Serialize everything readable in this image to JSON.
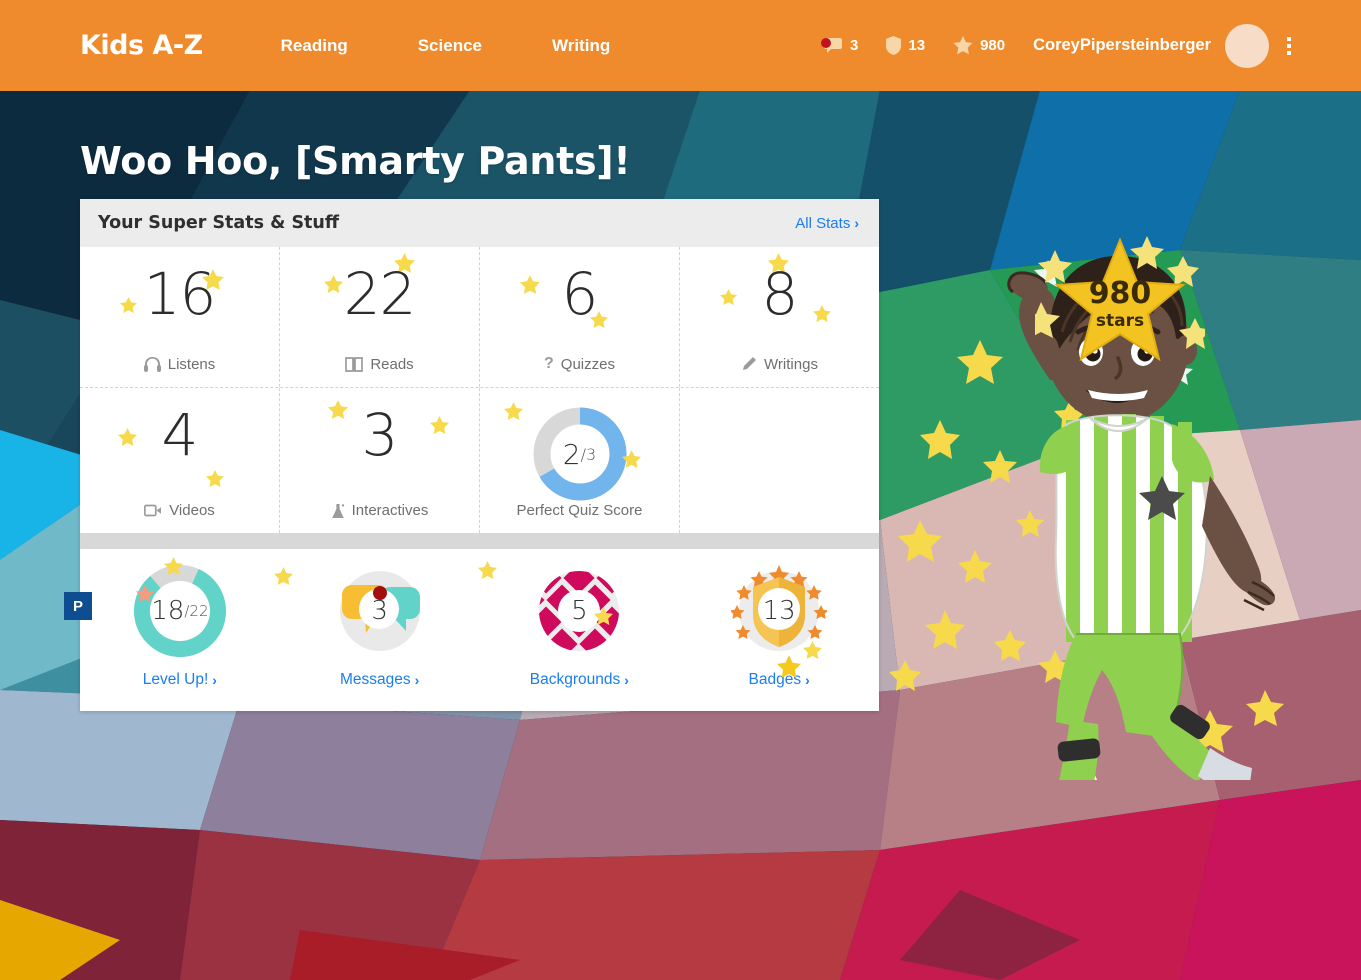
{
  "header": {
    "brand": "Kids A-Z",
    "nav": [
      {
        "label": "Reading"
      },
      {
        "label": "Science"
      },
      {
        "label": "Writing"
      }
    ],
    "stats": [
      {
        "icon": "speech-bubble-icon",
        "value": "3",
        "has_alert_dot": true
      },
      {
        "icon": "shield-icon",
        "value": "13"
      },
      {
        "icon": "star-icon",
        "value": "980"
      }
    ],
    "username": "CoreyPipersteinberger",
    "avatar": "user-avatar",
    "menu_icon": "kebab-menu-icon"
  },
  "greeting": "Woo Hoo, [Smarty Pants]!",
  "stats_card": {
    "title": "Your Super Stats & Stuff",
    "all_stats_label": "All Stats",
    "all_stats_chevron": "›",
    "row1": [
      {
        "value": "16",
        "label": "Listens",
        "icon": "headphones-icon"
      },
      {
        "value": "22",
        "label": "Reads",
        "icon": "book-icon"
      },
      {
        "value": "6",
        "label": "Quizzes",
        "icon": "question-mark-icon"
      },
      {
        "value": "8",
        "label": "Writings",
        "icon": "pencil-icon"
      }
    ],
    "row2": [
      {
        "value": "4",
        "label": "Videos",
        "icon": "video-camera-icon"
      },
      {
        "value": "3",
        "label": "Interactives",
        "icon": "flask-icon"
      }
    ],
    "quiz_donut": {
      "label": "Perfect Quiz Score",
      "value": "2",
      "denominator": "/3",
      "progress_fraction": 0.6667,
      "arc_color": "#72b4ec",
      "track_color": "#d8d8d8"
    }
  },
  "badges": [
    {
      "name": "level-up",
      "value": "18",
      "denominator": "/22",
      "link_label": "Level Up!",
      "chevron": "›",
      "progress_fraction": 0.82,
      "arc_color": "#62d3c8",
      "track_color": "#d8d8d8"
    },
    {
      "name": "messages",
      "value": "3",
      "link_label": "Messages",
      "chevron": "›",
      "icon": "speech-bubbles-icon",
      "bubble_color_1": "#f7be34",
      "bubble_color_2": "#62d3c8",
      "alert_color": "#a30d0d"
    },
    {
      "name": "backgrounds",
      "value": "5",
      "link_label": "Backgrounds",
      "chevron": "›",
      "icon": "diamond-pattern-icon",
      "pattern_color": "#cf0a5c"
    },
    {
      "name": "badges",
      "value": "13",
      "link_label": "Badges",
      "chevron": "›",
      "icon": "shield-badge-icon",
      "shield_color": "#f6c453",
      "star_color": "#ef8b2c"
    }
  ],
  "hero_star": {
    "value": "980",
    "label": "stars",
    "color": "#f3c421"
  },
  "pin_tab": {
    "label": "P",
    "color": "#0f4d91"
  },
  "mascot": {
    "name": "soccer-player-avatar"
  },
  "colors": {
    "header_orange": "#ef8b2c",
    "link_blue": "#1a7df0",
    "star_yellow": "#f7d94c",
    "card_head_grey": "#ececec"
  }
}
